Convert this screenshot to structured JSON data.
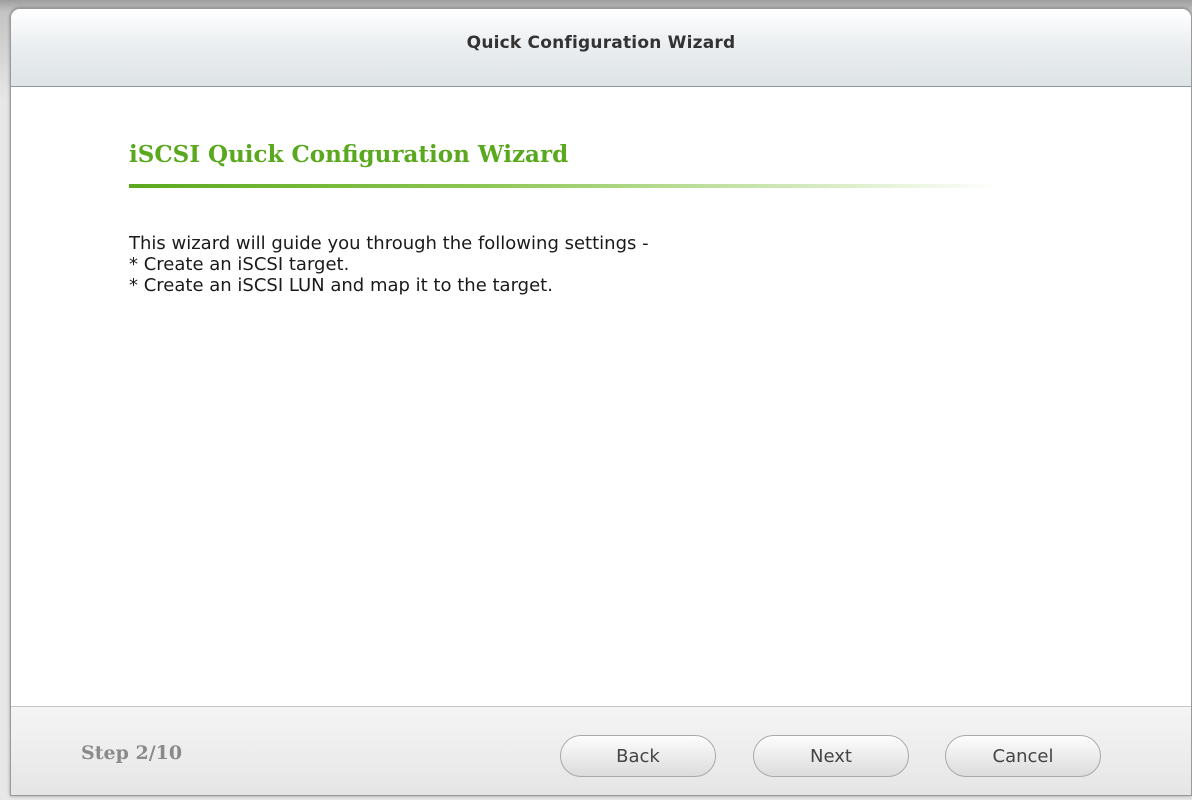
{
  "dialog": {
    "title": "Quick Configuration Wizard"
  },
  "content": {
    "heading": "iSCSI Quick Configuration Wizard",
    "description_lines": [
      "This wizard will guide you through the following settings -",
      "* Create an iSCSI target.",
      "* Create an iSCSI LUN and map it to the target."
    ]
  },
  "footer": {
    "step": "Step 2/10",
    "back_label": "Back",
    "next_label": "Next",
    "cancel_label": "Cancel"
  },
  "colors": {
    "heading_green": "#5aa81d",
    "step_gray": "#8a8a8a"
  }
}
